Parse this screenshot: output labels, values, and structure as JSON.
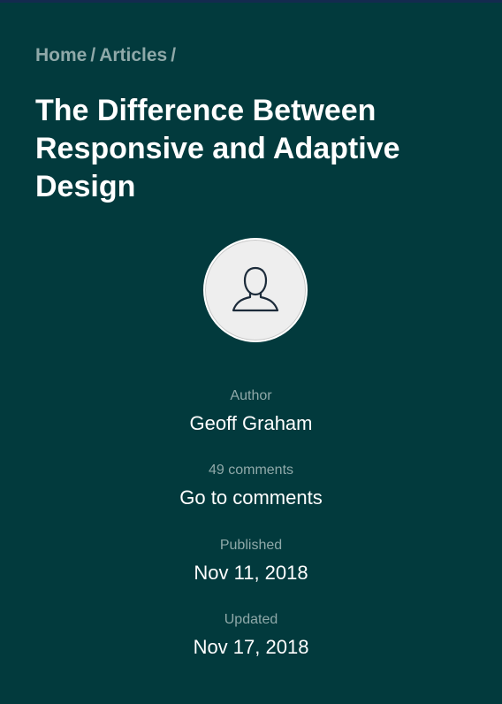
{
  "breadcrumb": {
    "home": "Home",
    "articles": "Articles",
    "separator": "/"
  },
  "article": {
    "title": "The Difference Between Responsive and Adaptive Design"
  },
  "avatar": {
    "icon": "user-icon"
  },
  "meta": {
    "author_label": "Author",
    "author_name": "Geoff Graham",
    "comments_count": "49 comments",
    "comments_link": "Go to comments",
    "published_label": "Published",
    "published_date": "Nov 11, 2018",
    "updated_label": "Updated",
    "updated_date": "Nov 17, 2018"
  },
  "colors": {
    "background": "#023a3d",
    "muted_text": "#8fa9a9",
    "primary_text": "#ffffff",
    "avatar_bg": "#eeeeee",
    "icon_stroke": "#1c2b3a"
  }
}
